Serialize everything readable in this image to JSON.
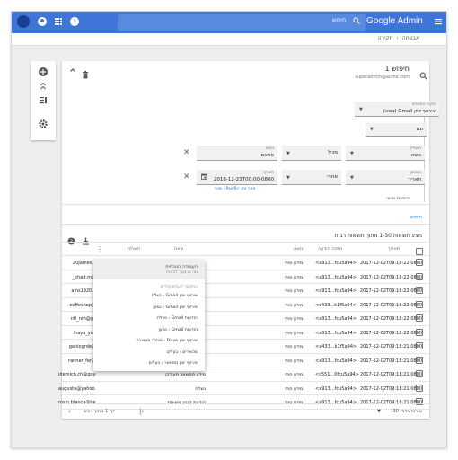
{
  "topbar": {
    "search_placeholder": "חיפוש",
    "logo": "Google Admin",
    "colors": {
      "bar": "#3f75d9",
      "search": "#5a89e0"
    }
  },
  "breadcrumb": {
    "parent": "אבטחה",
    "current": "חקירה"
  },
  "query": {
    "title": "חיפוש 1",
    "subtitle": "superadmin@acme.com",
    "datasource_label": "מקור הנתונים",
    "datasource_value": "אירועי יומן Gmail (בטא)",
    "and_value": "וגם",
    "cond1": {
      "attr_label": "מאפיין",
      "attr_value": "נושא",
      "op_value": "מכיל",
      "val_label": "נושא",
      "val_value": "ספאם"
    },
    "cond2": {
      "attr_label": "מאפיין",
      "attr_value": "תאריך",
      "op_value": "אחרי",
      "val_label": "תאריך",
      "val_value": "2018-12-23T00:00-0800",
      "tz_hint": "אזור זמן: Pacific · שינוי"
    },
    "add_condition": "הוספת תנאי",
    "search_button": "חיפוש"
  },
  "results": {
    "summary": "מציג תוצאות 1-30 מתוך תוצאות רבות",
    "columns": [
      "תאריך",
      "מזהה הודעה",
      "נושא",
      "מאת",
      "נמען",
      "השולח"
    ],
    "rows": [
      {
        "date": "2017-12-02T09:18:22-0800",
        "msgid": "<a913...fcu5a94>",
        "subject": "מידע סודי",
        "from": "",
        "to": "",
        "sender": "20James.o"
      },
      {
        "date": "2017-12-02T09:18:22-0800",
        "msgid": "<a913...fcu5a94>",
        "subject": "מידע סודי",
        "from": "",
        "to": "",
        "sender": "_chad.m@"
      },
      {
        "date": "2017-12-02T09:18:22-0800",
        "msgid": "<a913...fcu5a94>",
        "subject": "מידע סודי",
        "from": "",
        "to": "",
        "sender": "ains1920.o"
      },
      {
        "date": "2017-12-02T09:18:22-0800",
        "msgid": "<c433...k1f5a94>",
        "subject": "מידע סודי",
        "from": "",
        "to": "",
        "sender": "coffeshop@"
      },
      {
        "date": "2017-12-02T09:18:22-0800",
        "msgid": "<a913...fcu5a94>",
        "subject": "מידע סודי",
        "from": "",
        "to": "",
        "sender": "nti_nm@ge"
      },
      {
        "date": "2017-12-02T09:18:22-0800",
        "msgid": "<a913...fcu5a94>",
        "subject": "מידע סודי",
        "from": "",
        "to": "",
        "sender": "inaya_yon"
      },
      {
        "date": "2017-12-02T09:18:21-0800",
        "msgid": "<a433...k1f5a94>",
        "subject": "מידע סודי",
        "from": "",
        "to": "",
        "sender": "ganiogrde@"
      },
      {
        "date": "2017-12-02T09:18:21-0800",
        "msgid": "<a913...fcu5a94>",
        "subject": "מידע סודי",
        "from": "",
        "to": "",
        "sender": "ranner_fer@"
      },
      {
        "date": "2017-12-02T09:18:21-0800",
        "msgid": "<c551...0fcu5a94>",
        "subject": "מידע סודי",
        "from": "מידע ממשאב מעודכן",
        "to": "",
        "sender": "idemich.ch@goyet.co"
      },
      {
        "date": "2017-12-02T09:18:21-0800",
        "msgid": "<a913...fcu5a94>",
        "subject": "מידע סודי",
        "from": "נשלח",
        "to": "",
        "sender": "augusta@yahoo.com"
      },
      {
        "date": "2017-12-02T09:18:21-0800",
        "msgid": "<a913...fcu5a94>",
        "subject": "מידע סודי",
        "from": "הודעת קובץ משותף",
        "to": "",
        "sender": "rosin.blanca@heller.ar"
      }
    ]
  },
  "dropdown": {
    "header_line1": "העמודה הנוכחית",
    "header_line2": "מה ברצונך להציג?",
    "section": "המקשר לעולם צדדים",
    "items": [
      "אירועי יומן Gmail ‹ נשלח",
      "אירועי יומן Gmail ‹ נמען",
      "הודעות Gmail ‹ נשלח",
      "הודעות Gmail ‹ נמען",
      "אירועי יומן Drive ‹ מכונה מעוצבת",
      "מכשירים ‹ בעלים",
      "אירועי יומן מסמאר ‹ בעלים"
    ]
  },
  "footer": {
    "rows_per_page": "שורות בדף: 30",
    "page_label": "דף 1 מתוך רבים"
  }
}
